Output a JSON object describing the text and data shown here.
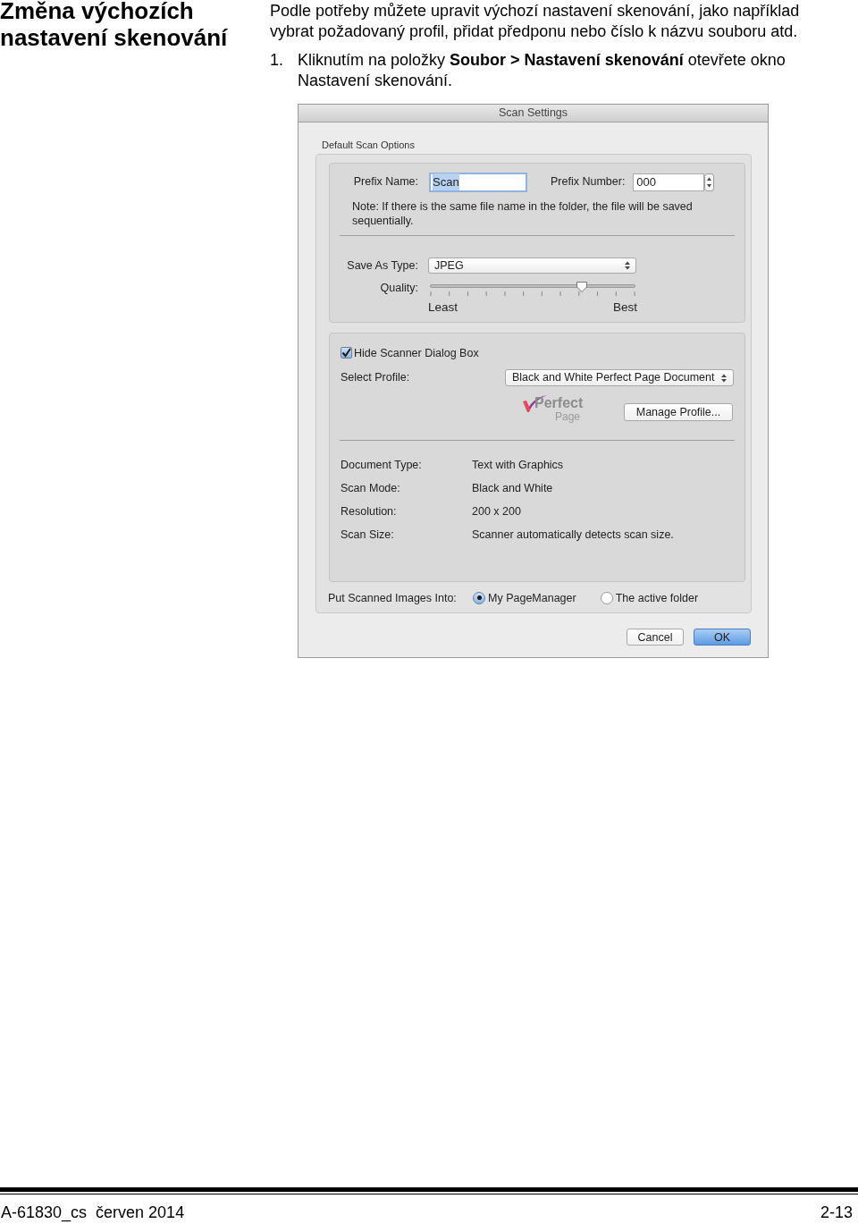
{
  "heading": "Změna výchozích nastavení skenování",
  "intro": "Podle potřeby můžete upravit výchozí nastavení skenování, jako například vybrat požadovaný profil, přidat předponu nebo číslo k názvu souboru atd.",
  "steps": [
    {
      "number": "1.",
      "text": "Kliknutím na položky **Soubor > Nastavení skenování** otevřete okno Nastavení skenování."
    }
  ],
  "dialog": {
    "title": "Scan Settings",
    "group_label": "Default Scan Options",
    "prefix_name": {
      "label": "Prefix Name:",
      "value": "Scan"
    },
    "prefix_number": {
      "label": "Prefix Number:",
      "value": "000"
    },
    "note": "Note: If there is the same file name in the folder, the file will be saved sequentially.",
    "save_as_type": {
      "label": "Save As Type:",
      "value": "JPEG"
    },
    "quality": {
      "label": "Quality:",
      "level": 0.74,
      "min_label": "Least",
      "max_label": "Best"
    },
    "hide_dialog": {
      "label": "Hide Scanner Dialog Box",
      "checked": true
    },
    "select_profile": {
      "label": "Select Profile:",
      "value": "Black and White Perfect Page Document"
    },
    "profile_logo": [
      "Perfect",
      "Page"
    ],
    "manage_button": "Manage Profile...",
    "details": [
      {
        "label": "Document Type:",
        "value": "Text with Graphics"
      },
      {
        "label": "Scan Mode:",
        "value": "Black and White"
      },
      {
        "label": "Resolution:",
        "value": "200 x 200"
      },
      {
        "label": "Scan Size:",
        "value": "Scanner automatically detects scan size."
      }
    ],
    "destination": {
      "label": "Put Scanned Images Into:",
      "options": [
        {
          "label": "My PageManager",
          "selected": true
        },
        {
          "label": "The active folder",
          "selected": false
        }
      ]
    },
    "buttons": [
      {
        "label": "Cancel",
        "default": false
      },
      {
        "label": "OK",
        "default": true
      }
    ]
  },
  "footer": {
    "left": "A-61830_cs  červen 2014",
    "right": "2-13"
  }
}
